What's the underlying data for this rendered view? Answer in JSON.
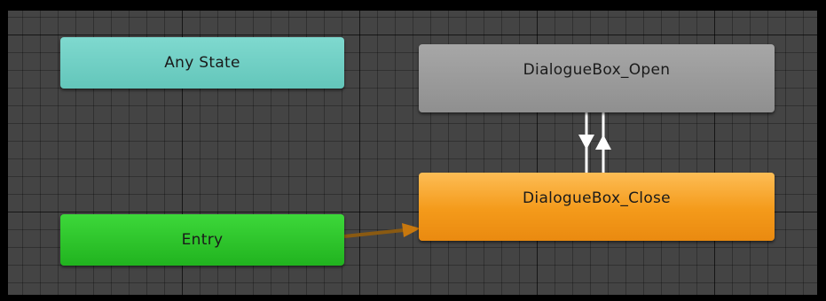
{
  "animator": {
    "states": {
      "any_state": {
        "label": "Any State",
        "color": "#6fcfc4"
      },
      "entry": {
        "label": "Entry",
        "color": "#2dc82b"
      },
      "dialoguebox_open": {
        "label": "DialogueBox_Open",
        "color": "#9b9b9b"
      },
      "dialoguebox_close": {
        "label": "DialogueBox_Close",
        "color": "#f49a1a",
        "is_default": true
      }
    },
    "transitions": [
      {
        "from": "Entry",
        "to": "DialogueBox_Close",
        "color": "#c8780e"
      },
      {
        "from": "DialogueBox_Open",
        "to": "DialogueBox_Close",
        "color": "#ffffff"
      },
      {
        "from": "DialogueBox_Close",
        "to": "DialogueBox_Open",
        "color": "#ffffff"
      }
    ],
    "grid_background": "#444444"
  }
}
